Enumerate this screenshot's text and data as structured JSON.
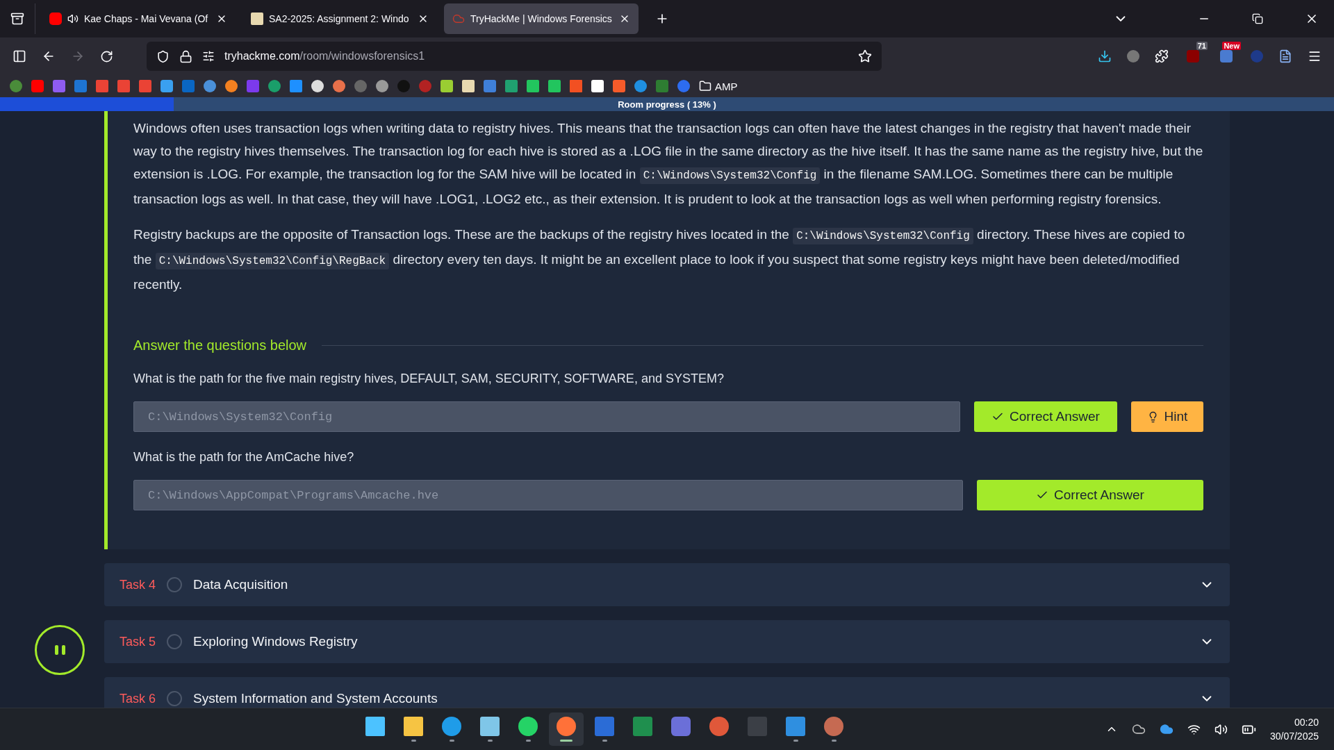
{
  "browser": {
    "tabs": [
      {
        "title": "Kae Chaps - Mai Vevana (Of",
        "kind": "video",
        "audio": true,
        "selected": false
      },
      {
        "title": "SA2-2025: Assignment 2: Windo",
        "kind": "doc",
        "audio": false,
        "selected": false
      },
      {
        "title": "TryHackMe | Windows Forensics",
        "kind": "cloud",
        "audio": false,
        "selected": true
      }
    ],
    "nav": {
      "forward_disabled": true
    },
    "url": {
      "host": "tryhackme.com",
      "path": "/room/windowsforensics1"
    },
    "extension_badges": [
      "71",
      "New"
    ],
    "bookmark_folder": "AMP"
  },
  "progress": {
    "label": "Room progress ( 13% )",
    "level": 0.13
  },
  "task": {
    "paragraphs": [
      [
        {
          "kind": "text",
          "text": "Windows often uses transaction logs when writing data to registry hives. This means that the transaction logs can often have the latest changes in the registry that haven't made their way to the registry hives themselves. The transaction log for each hive is stored as a .LOG file in the same directory as the hive itself. It has the same name as the registry hive, but the extension is .LOG. For example, the transaction log for the SAM hive will be located in "
        },
        {
          "kind": "code",
          "text": "C:\\Windows\\System32\\Config"
        },
        {
          "kind": "text",
          "text": " in the filename SAM.LOG. Sometimes there can be multiple transaction logs as well. In that case, they will have .LOG1, .LOG2 etc., as their extension. It is prudent to look at the transaction logs as well when performing registry forensics."
        }
      ],
      [
        {
          "kind": "text",
          "text": "Registry backups are the opposite of Transaction logs. These are the backups of the registry hives located in the "
        },
        {
          "kind": "code",
          "text": "C:\\Windows\\System32\\Config"
        },
        {
          "kind": "text",
          "text": " directory. These hives are copied to the "
        },
        {
          "kind": "code",
          "text": "C:\\Windows\\System32\\Config\\RegBack"
        },
        {
          "kind": "text",
          "text": " directory every ten days. It might be an excellent place to look if you suspect that some registry keys might have been deleted/modified recently."
        }
      ]
    ],
    "questions_heading": "Answer the questions below",
    "questions": [
      {
        "question": "What is the path for the five main registry hives, DEFAULT, SAM, SECURITY, SOFTWARE, and SYSTEM?",
        "answer": "C:\\Windows\\System32\\Config",
        "status": "Correct Answer",
        "hint": "Hint"
      },
      {
        "question": "What is the path for the AmCache hive?",
        "answer": "C:\\Windows\\AppCompat\\Programs\\Amcache.hve",
        "status": "Correct Answer"
      }
    ]
  },
  "tasks": [
    {
      "number": "Task 4",
      "title": "Data Acquisition",
      "completed": false
    },
    {
      "number": "Task 5",
      "title": "Exploring Windows Registry",
      "completed": false
    },
    {
      "number": "Task 6",
      "title": "System Information and System Accounts",
      "completed": false
    }
  ],
  "taskbar": {
    "apps": [
      {
        "running": false,
        "selected": false
      },
      {
        "running": true,
        "selected": false
      },
      {
        "running": true,
        "selected": false
      },
      {
        "running": true,
        "selected": false
      },
      {
        "running": true,
        "selected": false
      },
      {
        "running": true,
        "selected": true
      },
      {
        "running": true,
        "selected": false
      },
      {
        "running": false,
        "selected": false
      },
      {
        "running": false,
        "selected": false
      },
      {
        "running": false,
        "selected": false
      },
      {
        "running": false,
        "selected": false
      },
      {
        "running": true,
        "selected": false
      },
      {
        "running": true,
        "selected": false
      }
    ],
    "time": "00:20",
    "date": "30/07/2025"
  }
}
